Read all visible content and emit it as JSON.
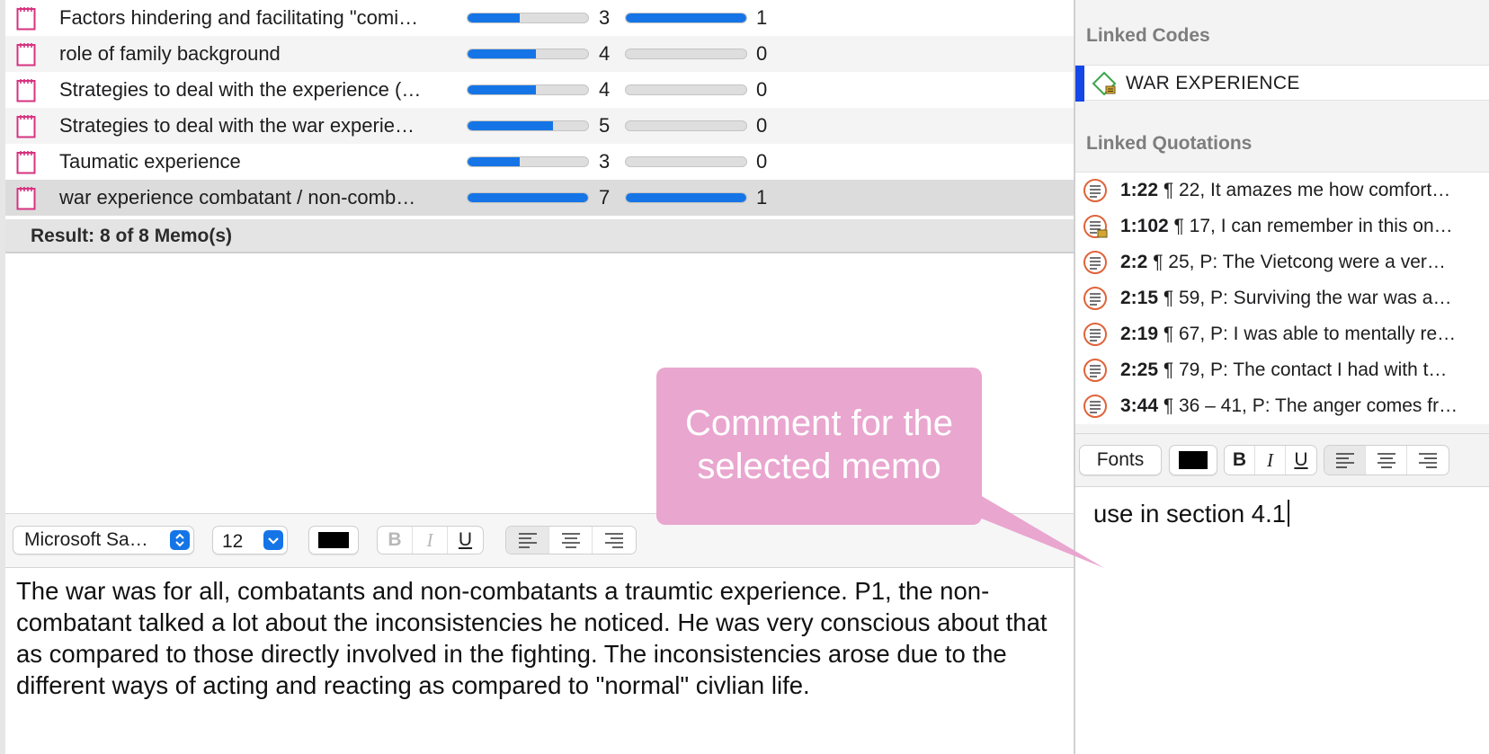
{
  "memo_list": {
    "rows": [
      {
        "name": "Factors hindering and facilitating \"comi…",
        "count1": "3",
        "bar1_fraction": 0.43,
        "count2": "1",
        "bar2_fraction": 1.0,
        "style": "normal"
      },
      {
        "name": "role of family background",
        "count1": "4",
        "bar1_fraction": 0.57,
        "count2": "0",
        "bar2_fraction": 0.0,
        "style": "alt"
      },
      {
        "name": "Strategies to deal with the experience (…",
        "count1": "4",
        "bar1_fraction": 0.57,
        "count2": "0",
        "bar2_fraction": 0.0,
        "style": "normal"
      },
      {
        "name": "Strategies to deal with the war experie…",
        "count1": "5",
        "bar1_fraction": 0.71,
        "count2": "0",
        "bar2_fraction": 0.0,
        "style": "alt"
      },
      {
        "name": "Taumatic experience",
        "count1": "3",
        "bar1_fraction": 0.43,
        "count2": "0",
        "bar2_fraction": 0.0,
        "style": "normal"
      },
      {
        "name": "war experience combatant / non-comb…",
        "count1": "7",
        "bar1_fraction": 1.0,
        "count2": "1",
        "bar2_fraction": 1.0,
        "style": "selected"
      }
    ],
    "result": "Result: 8 of 8 Memo(s)"
  },
  "memo_editor": {
    "font_name": "Microsoft Sa…",
    "font_size": "12",
    "bold": "B",
    "italic": "I",
    "underline": "U",
    "text": "The war was for all, combatants and non-combatants a traumtic experience. P1, the non-combatant talked a lot about the inconsistencies he noticed. He was very conscious about that as compared to those directly involved in the fighting. The inconsistencies arose due to the different ways of acting and reacting as compared to \"normal\" civlian life."
  },
  "right_panel": {
    "linked_codes_heading": "Linked Codes",
    "codes": [
      {
        "label": "WAR EXPERIENCE",
        "icon": "code-diamond-icon"
      }
    ],
    "linked_quotations_heading": "Linked Quotations",
    "quotations": [
      {
        "id": "1:22",
        "text": " ¶ 22, It amazes me how comfort…",
        "has_comment": false
      },
      {
        "id": "1:102",
        "text": " ¶ 17, I can remember in this on…",
        "has_comment": true
      },
      {
        "id": "2:2",
        "text": " ¶ 25, P:  The Vietcong were a ver…",
        "has_comment": false
      },
      {
        "id": "2:15",
        "text": " ¶ 59, P: Surviving the war was a…",
        "has_comment": false
      },
      {
        "id": "2:19",
        "text": " ¶ 67, P: I was able to mentally re…",
        "has_comment": false
      },
      {
        "id": "2:25",
        "text": " ¶ 79, P: The contact I had with t…",
        "has_comment": false
      },
      {
        "id": "3:44",
        "text": " ¶ 36 – 41, P: The anger comes fr…",
        "has_comment": false
      }
    ],
    "fonts_button": "Fonts",
    "bold": "B",
    "italic": "I",
    "underline": "U",
    "comment_text": "use in section 4.1"
  },
  "callout": {
    "text_line1": "Comment for the",
    "text_line2": "selected memo"
  },
  "colors": {
    "accent_blue": "#1575e6",
    "code_accent": "#1347e8",
    "memo_icon": "#d6337f",
    "quote_icon": "#e0633a",
    "callout_bg": "#e9a6cf"
  }
}
